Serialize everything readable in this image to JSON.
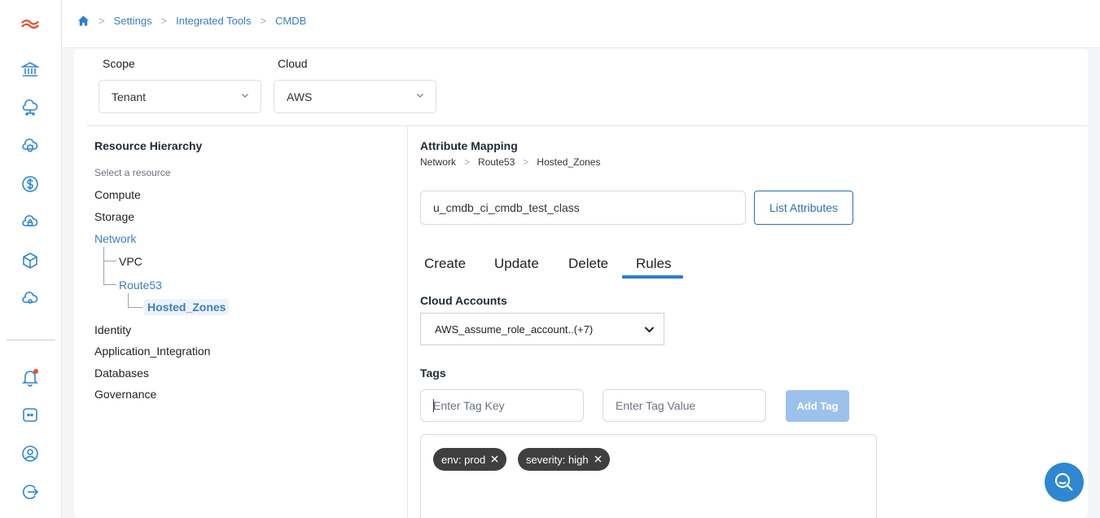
{
  "breadcrumb": [
    "Settings",
    "Integrated Tools",
    "CMDB"
  ],
  "sidebar": {
    "icons": [
      "logo-icon",
      "bank-icon",
      "cloud-network-icon",
      "cloud-shield-icon",
      "dollar-icon",
      "cloud-lock-icon",
      "cube-icon",
      "cloud-gear-icon",
      "bell-icon",
      "chat-icon",
      "user-icon",
      "logout-icon"
    ],
    "accent": "#2f86d2",
    "notification_color": "#e8552a"
  },
  "scope": {
    "label": "Scope",
    "value": "Tenant"
  },
  "cloud": {
    "label": "Cloud",
    "value": "AWS"
  },
  "tree": {
    "title": "Resource Hierarchy",
    "subtitle": "Select a resource",
    "items": [
      "Compute",
      "Storage",
      "Network",
      "VPC",
      "Route53",
      "Hosted_Zones",
      "Identity",
      "Application_Integration",
      "Databases",
      "Governance"
    ]
  },
  "mapping": {
    "title": "Attribute Mapping",
    "path": [
      "Network",
      "Route53",
      "Hosted_Zones"
    ],
    "class_value": "u_cmdb_ci_cmdb_test_class",
    "list_button": "List Attributes"
  },
  "tabs": [
    "Create",
    "Update",
    "Delete",
    "Rules"
  ],
  "active_tab": "Rules",
  "cloud_accounts": {
    "label": "Cloud Accounts",
    "value": "AWS_assume_role_account..(+7)"
  },
  "tags": {
    "label": "Tags",
    "key_placeholder": "Enter Tag Key",
    "value_placeholder": "Enter Tag Value",
    "add_button": "Add Tag",
    "chips": [
      "env: prod",
      "severity: high"
    ]
  }
}
